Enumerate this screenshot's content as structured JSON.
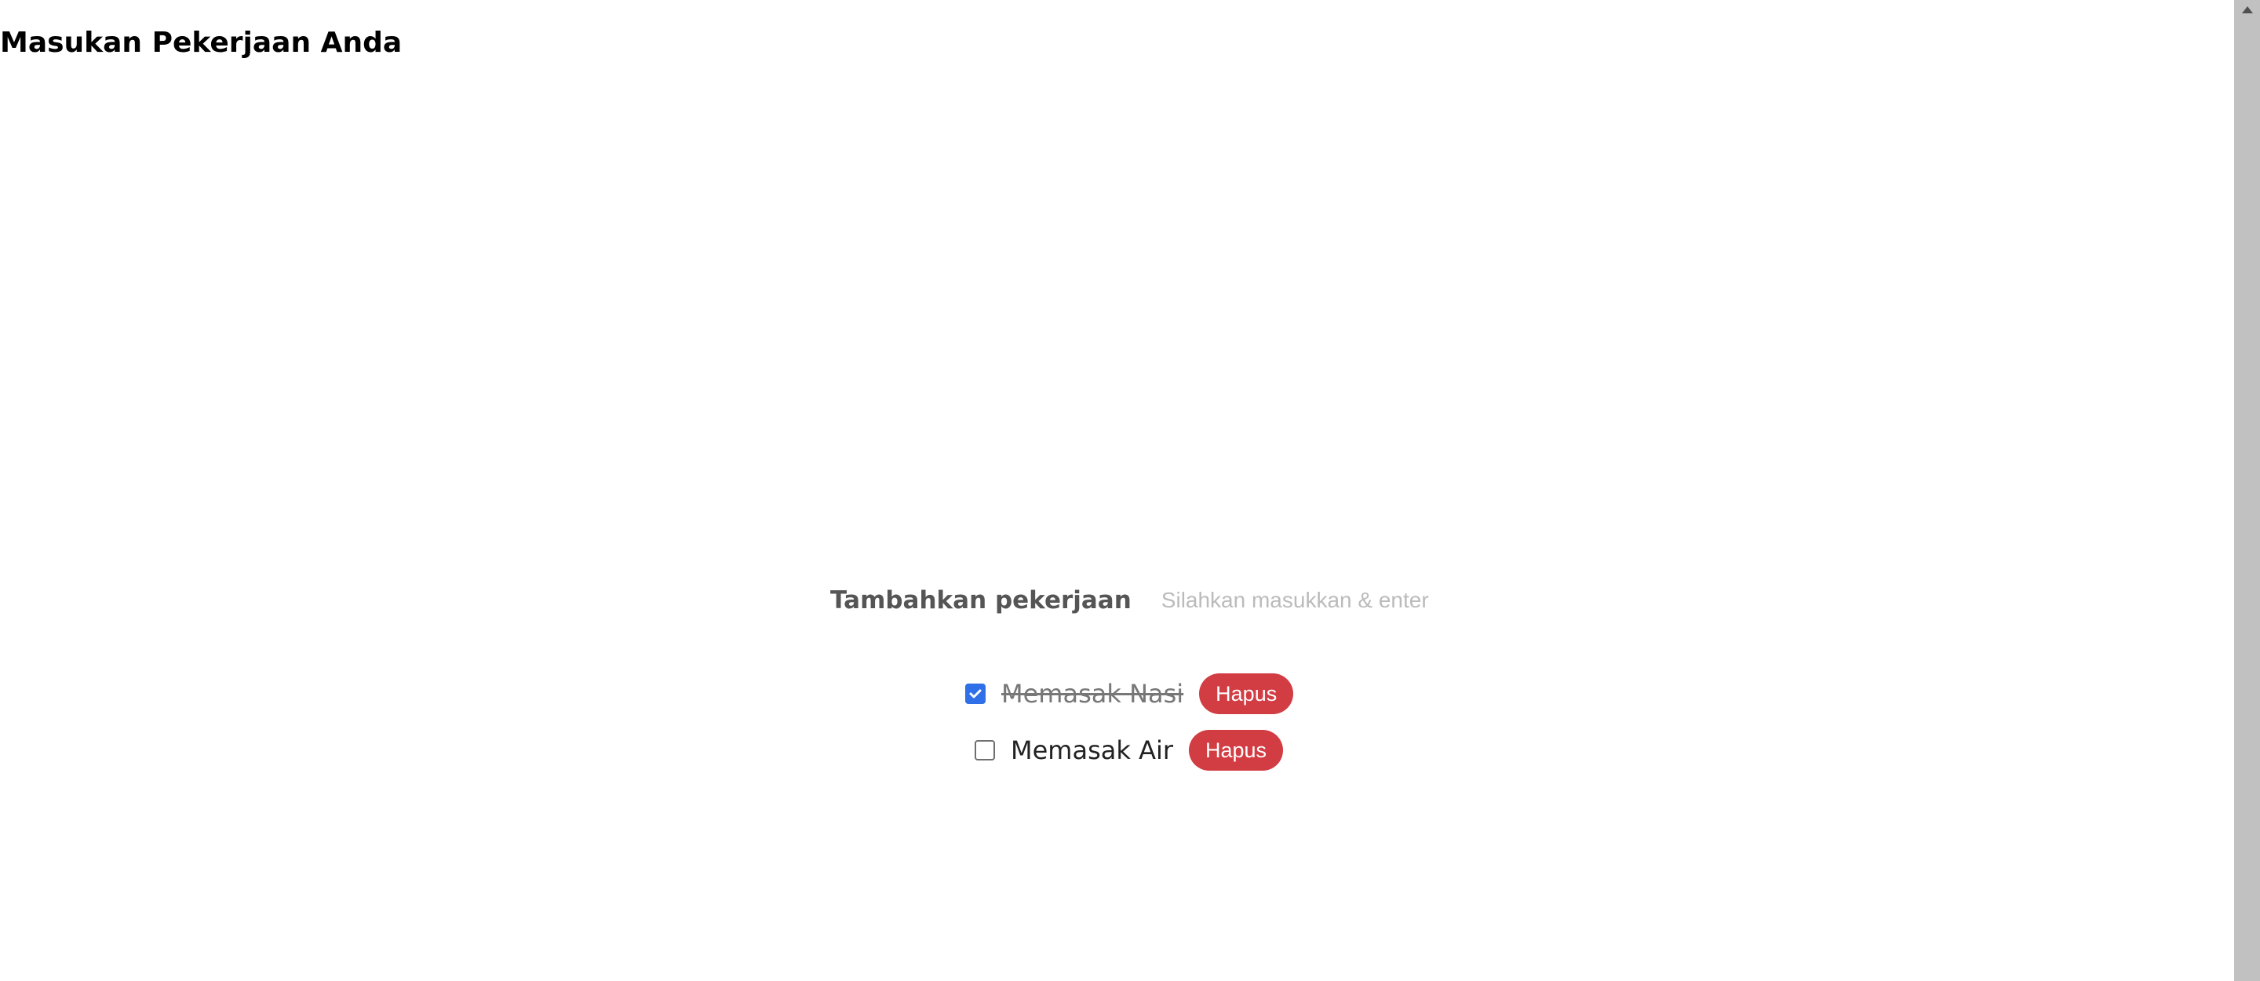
{
  "page": {
    "title": "Masukan Pekerjaan Anda"
  },
  "form": {
    "label": "Tambahkan pekerjaan",
    "input_value": "",
    "placeholder": "Silahkan masukkan & enter"
  },
  "tasks": [
    {
      "text": "Memasak Nasi",
      "completed": true,
      "delete_label": "Hapus"
    },
    {
      "text": "Memasak Air",
      "completed": false,
      "delete_label": "Hapus"
    }
  ],
  "icons": {
    "checkbox_checked": "check-icon",
    "scroll_up": "chevron-up-icon"
  },
  "colors": {
    "accent_blue": "#2f6fe8",
    "delete_red": "#d23c43",
    "placeholder_gray": "#bbbbbb",
    "label_gray": "#555555",
    "scrollbar": "#c1c1c1"
  }
}
